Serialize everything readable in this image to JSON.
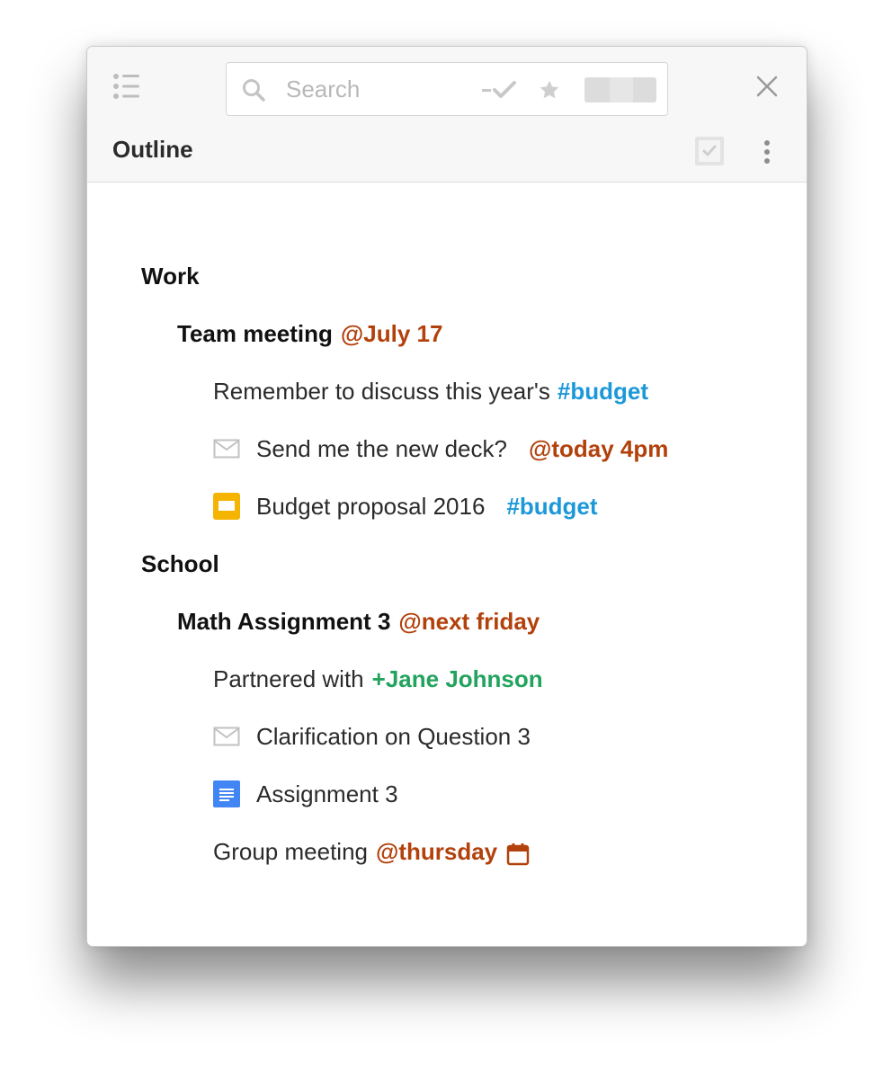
{
  "header": {
    "title": "Outline",
    "search": {
      "placeholder": "Search",
      "value": ""
    }
  },
  "icons": {
    "menu": "list-icon",
    "search": "search-icon",
    "done_filter": "dash-check-icon",
    "star_filter": "star-icon",
    "toggle": "toggle-icon",
    "close": "close-icon",
    "checklist": "checklist-icon",
    "more": "more-vertical-icon",
    "email": "envelope-icon",
    "slides": "slides-icon",
    "doc": "document-icon",
    "calendar": "calendar-icon"
  },
  "colors": {
    "date_tag": "#b2410c",
    "hashtag": "#1c98d9",
    "person_tag": "#22a35e",
    "slides_icon": "#f4b400",
    "doc_icon": "#4285f4"
  },
  "outline": {
    "work": {
      "label": "Work",
      "meeting": {
        "text": "Team meeting",
        "tag": "@July 17"
      },
      "note": {
        "text": "Remember to discuss this year's",
        "tag": "#budget"
      },
      "email": {
        "text": "Send me the new deck?",
        "tag": "@today 4pm"
      },
      "slides": {
        "text": "Budget proposal 2016",
        "tag": "#budget"
      }
    },
    "school": {
      "label": "School",
      "assignment": {
        "text": "Math Assignment 3",
        "tag": "@next friday"
      },
      "partner": {
        "text": "Partnered with",
        "tag": "+Jane Johnson"
      },
      "email": {
        "text": "Clarification on Question 3"
      },
      "doc": {
        "text": "Assignment 3"
      },
      "group": {
        "text": "Group meeting",
        "tag": "@thursday"
      }
    }
  }
}
